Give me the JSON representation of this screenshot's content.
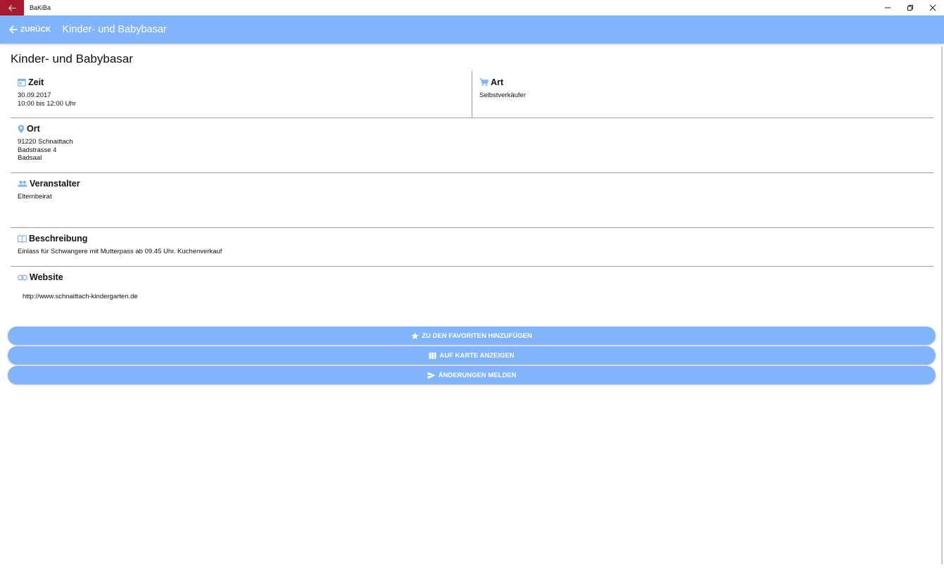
{
  "window": {
    "title": "BaKiBa"
  },
  "appbar": {
    "back_label": "ZURÜCK",
    "title": "Kinder- und Babybasar"
  },
  "page": {
    "title": "Kinder- und Babybasar"
  },
  "sections": {
    "zeit": {
      "title": "Zeit",
      "lines": [
        "30.09.2017",
        "10:00 bis 12:00 Uhr"
      ],
      "icon": "calendar-icon"
    },
    "art": {
      "title": "Art",
      "lines": [
        "Selbstverkäufer"
      ],
      "icon": "cart-icon"
    },
    "ort": {
      "title": "Ort",
      "lines": [
        "91220 Schnaittach",
        "Badstrasse 4",
        "Badsaal"
      ],
      "icon": "location-pin-icon"
    },
    "veranstalter": {
      "title": "Veranstalter",
      "lines": [
        "Elternbeirat"
      ],
      "icon": "people-icon"
    },
    "beschreibung": {
      "title": "Beschreibung",
      "lines": [
        "Einlass für Schwangere mit Mutterpass ab 09.45 Uhr. Kuchenverkauf"
      ],
      "icon": "book-icon"
    },
    "website": {
      "title": "Website",
      "url": "http://www.schnaittach-kindergarten.de",
      "icon": "link-icon"
    }
  },
  "buttons": {
    "favorites": {
      "label": "ZU DEN FAVORITEN HINZUFÜGEN",
      "icon": "star-icon"
    },
    "map": {
      "label": "AUF KARTE ANZEIGEN",
      "icon": "map-icon"
    },
    "report": {
      "label": "ÄNDERUNGEN MELDEN",
      "icon": "send-icon"
    }
  },
  "colors": {
    "accent": "#80b4fd",
    "back_button": "#a8182e",
    "divider": "#9e9e9e"
  }
}
